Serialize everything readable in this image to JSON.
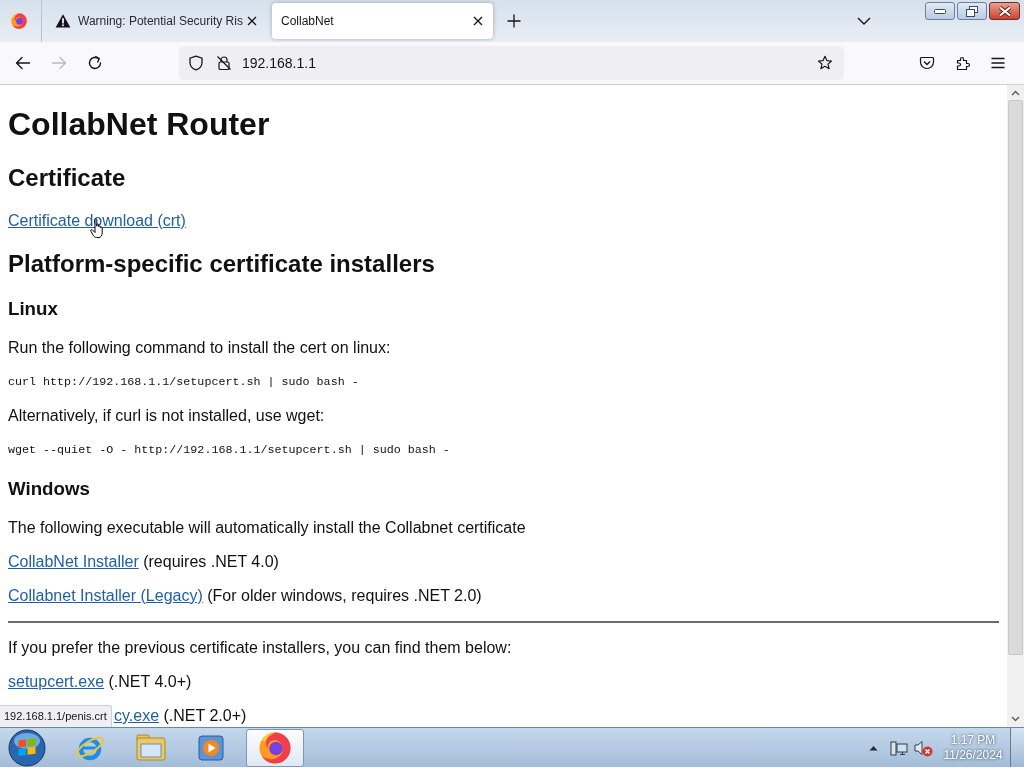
{
  "browser": {
    "tabs": [
      {
        "kind": "warning",
        "title": "Warning: Potential Security Ris",
        "selected": false
      },
      {
        "kind": "plain",
        "title": "CollabNet",
        "selected": true
      }
    ],
    "nav_buttons": [
      {
        "kind": "back",
        "disabled": false
      },
      {
        "kind": "forward",
        "disabled": true
      },
      {
        "kind": "reload",
        "disabled": false
      }
    ],
    "address": "192.168.1.1",
    "link_preview": "192.168.1.1/penis.crt"
  },
  "page": {
    "blocks": [
      {
        "kind": "h1",
        "text": "CollabNet Router"
      },
      {
        "kind": "h2",
        "text": "Certificate"
      },
      {
        "kind": "p",
        "parts": [
          {
            "kind": "link",
            "text": "Certificate download (crt)"
          }
        ]
      },
      {
        "kind": "h2",
        "text": "Platform-specific certificate installers"
      },
      {
        "kind": "h3",
        "text": "Linux"
      },
      {
        "kind": "p",
        "parts": [
          {
            "kind": "text",
            "text": "Run the following command to install the cert on linux:"
          }
        ]
      },
      {
        "kind": "code",
        "text": "curl http://192.168.1.1/setupcert.sh | sudo bash -"
      },
      {
        "kind": "p",
        "parts": [
          {
            "kind": "text",
            "text": "Alternatively, if curl is not installed, use wget:"
          }
        ]
      },
      {
        "kind": "code",
        "text": "wget --quiet -O - http://192.168.1.1/setupcert.sh | sudo bash -"
      },
      {
        "kind": "h3",
        "text": "Windows"
      },
      {
        "kind": "p",
        "parts": [
          {
            "kind": "text",
            "text": "The following executable will automatically install the Collabnet certificate"
          }
        ]
      },
      {
        "kind": "p",
        "parts": [
          {
            "kind": "link",
            "text": "CollabNet Installer"
          },
          {
            "kind": "text",
            "text": " (requires .NET 4.0)"
          }
        ]
      },
      {
        "kind": "p",
        "parts": [
          {
            "kind": "link",
            "text": "Collabnet Installer (Legacy)"
          },
          {
            "kind": "text",
            "text": " (For older windows, requires .NET 2.0)"
          }
        ]
      },
      {
        "kind": "hr"
      },
      {
        "kind": "p",
        "parts": [
          {
            "kind": "text",
            "text": "If you prefer the previous certificate installers, you can find them below:"
          }
        ]
      },
      {
        "kind": "p",
        "parts": [
          {
            "kind": "link",
            "text": "setupcert.exe"
          },
          {
            "kind": "text",
            "text": " (.NET 4.0+)"
          }
        ]
      },
      {
        "kind": "clipped",
        "parts": [
          {
            "kind": "link",
            "text": "cy.exe"
          },
          {
            "kind": "text",
            "text": " (.NET 2.0+)"
          }
        ]
      }
    ]
  },
  "taskbar": {
    "apps": [
      {
        "kind": "ie",
        "active": false
      },
      {
        "kind": "explorer",
        "active": false
      },
      {
        "kind": "media",
        "active": false
      },
      {
        "kind": "firefox",
        "active": true
      }
    ],
    "clock": {
      "time": "1:17 PM",
      "date": "11/26/2024"
    }
  }
}
